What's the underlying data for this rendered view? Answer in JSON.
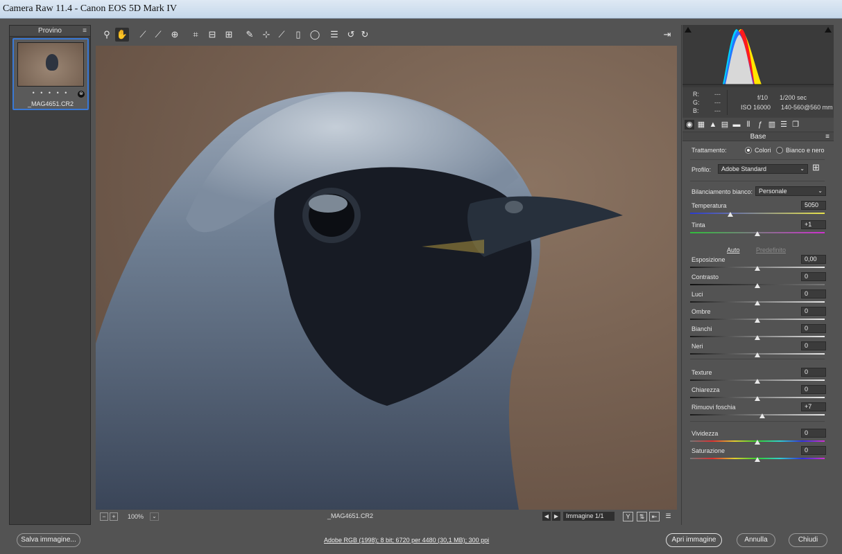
{
  "window": {
    "title": "Camera Raw 11.4  -  Canon EOS 5D Mark IV"
  },
  "filmstrip": {
    "header": "Provino",
    "stars": "• • • • •",
    "filename": "_MAG4651.CR2"
  },
  "toolbar": {
    "icons": [
      "zoom-icon",
      "hand-icon",
      "white-balance-icon",
      "color-sampler-icon",
      "target-adjust-icon",
      "crop-icon",
      "straighten-icon",
      "transform-icon",
      "spot-removal-icon",
      "red-eye-icon",
      "adjustment-brush-icon",
      "graduated-filter-icon",
      "radial-filter-icon",
      "presets-list-icon",
      "rotate-left-icon",
      "rotate-right-icon",
      "export-icon"
    ]
  },
  "status": {
    "zoom": "100%",
    "filename": "_MAG4651.CR2",
    "image_count": "Immagine 1/1"
  },
  "histogram": {
    "r_label": "R:",
    "g_label": "G:",
    "b_label": "B:",
    "r_value": "---",
    "g_value": "---",
    "b_value": "---",
    "aperture": "f/10",
    "shutter": "1/200 sec",
    "iso": "ISO 16000",
    "lens": "140-560@560 mm"
  },
  "panel": {
    "section": "Base",
    "treatment_label": "Trattamento:",
    "treatment_options": [
      "Colori",
      "Bianco e nero"
    ],
    "treatment_selected": "Colori",
    "profile_label": "Profilo:",
    "profile_value": "Adobe Standard",
    "wb_label": "Bilanciamento bianco:",
    "wb_value": "Personale",
    "auto_link": "Auto",
    "default_link": "Predefinito",
    "sliders": [
      {
        "label": "Temperatura",
        "value": "5050",
        "position": 0.3
      },
      {
        "label": "Tinta",
        "value": "+1",
        "position": 0.5
      },
      {
        "label": "Esposizione",
        "value": "0,00",
        "position": 0.5
      },
      {
        "label": "Contrasto",
        "value": "0",
        "position": 0.5
      },
      {
        "label": "Luci",
        "value": "0",
        "position": 0.5
      },
      {
        "label": "Ombre",
        "value": "0",
        "position": 0.5
      },
      {
        "label": "Bianchi",
        "value": "0",
        "position": 0.5
      },
      {
        "label": "Neri",
        "value": "0",
        "position": 0.5
      },
      {
        "label": "Texture",
        "value": "0",
        "position": 0.5
      },
      {
        "label": "Chiarezza",
        "value": "0",
        "position": 0.5
      },
      {
        "label": "Rimuovi foschia",
        "value": "+7",
        "position": 0.535
      },
      {
        "label": "Vividezza",
        "value": "0",
        "position": 0.5
      },
      {
        "label": "Saturazione",
        "value": "0",
        "position": 0.5
      }
    ]
  },
  "bottom": {
    "save": "Salva immagine...",
    "workflow": "Adobe RGB (1998); 8 bit; 6720 per 4480 (30,1 MB); 300 ppi",
    "open": "Apri immagine",
    "cancel": "Annulla",
    "close": "Chiudi"
  },
  "colors": {
    "accent": "#3a79d6",
    "panel": "#535353",
    "dark": "#3a3a3a"
  }
}
